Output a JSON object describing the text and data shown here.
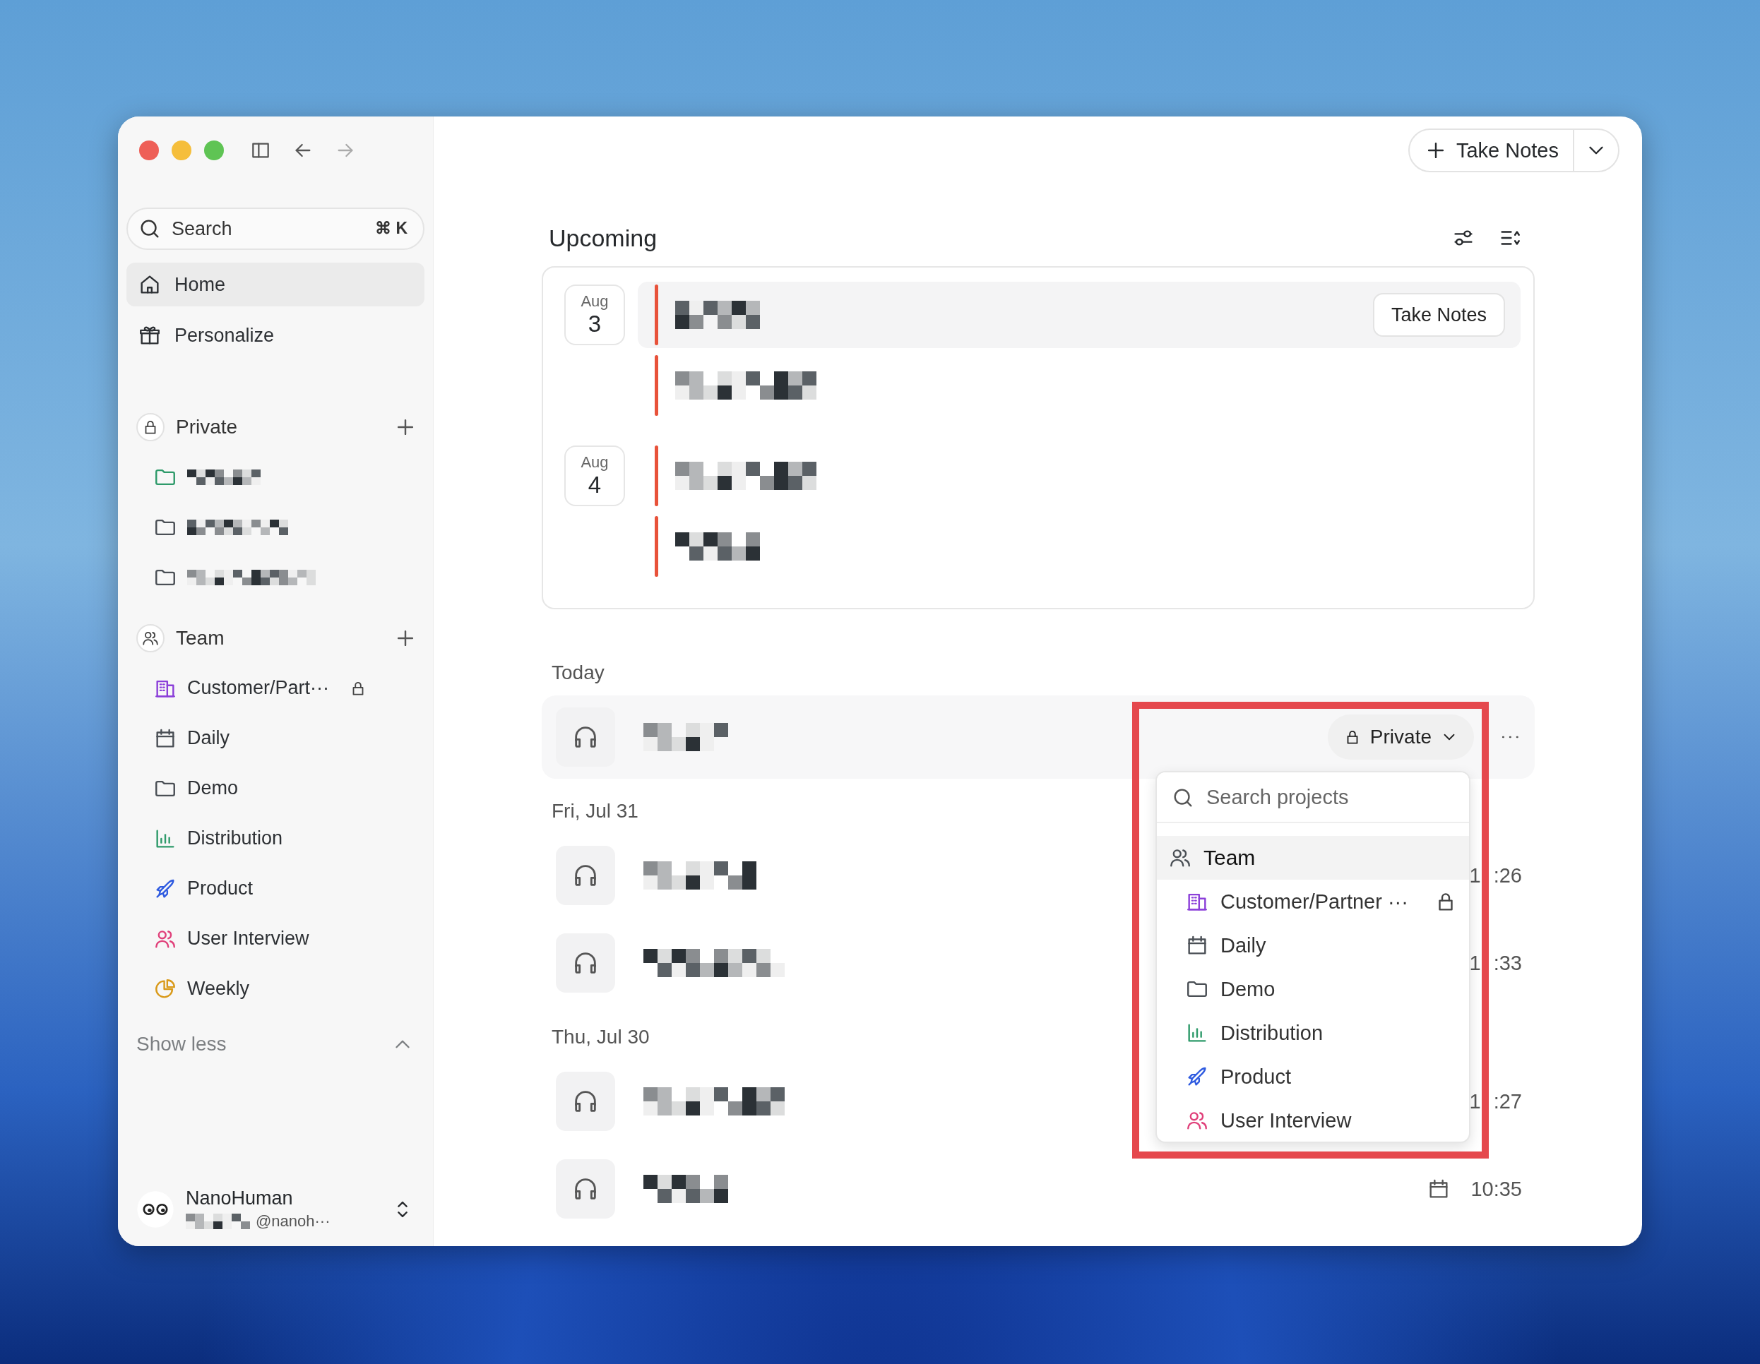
{
  "sidebar": {
    "search": {
      "placeholder": "Search",
      "shortcut": "⌘ K"
    },
    "nav": [
      {
        "label": "Home",
        "selected": true
      },
      {
        "label": "Personalize",
        "selected": false
      }
    ],
    "sections": [
      {
        "title": "Private",
        "items": [
          {
            "kind": "folder",
            "color": "#2e9a6a",
            "selected": false
          },
          {
            "kind": "folder",
            "color": "#4a4f55",
            "selected": false
          },
          {
            "kind": "folder",
            "color": "#4a4f55",
            "selected": false
          }
        ]
      },
      {
        "title": "Team",
        "items": [
          {
            "kind": "building",
            "color": "#8b3fd9",
            "label": "Customer/Part···",
            "locked": true,
            "selected": false
          },
          {
            "kind": "calendar",
            "color": "#4a4f55",
            "label": "Daily",
            "locked": false,
            "selected": false
          },
          {
            "kind": "folder",
            "color": "#4a4f55",
            "label": "Demo",
            "locked": false,
            "selected": false
          },
          {
            "kind": "chart",
            "color": "#2e9a6a",
            "label": "Distribution",
            "locked": false,
            "selected": false
          },
          {
            "kind": "rocket",
            "color": "#2f5be0",
            "label": "Product",
            "locked": false,
            "selected": false
          },
          {
            "kind": "users",
            "color": "#e0407a",
            "label": "User Interview",
            "locked": false,
            "selected": false
          },
          {
            "kind": "pie",
            "color": "#d99a1a",
            "label": "Weekly",
            "locked": false,
            "selected": false
          }
        ]
      }
    ],
    "show_less": "Show less",
    "user": {
      "name": "NanoHuman",
      "email": "@nanoh···"
    }
  },
  "header": {
    "button": "Take Notes"
  },
  "upcoming": {
    "title": "Upcoming",
    "days": [
      {
        "month": "Aug",
        "day": "3",
        "events": [
          {
            "kind": "active",
            "action": "Take Notes"
          },
          {
            "kind": "plain"
          }
        ]
      },
      {
        "month": "Aug",
        "day": "4",
        "events": [
          {
            "kind": "plain"
          },
          {
            "kind": "plain"
          }
        ]
      }
    ]
  },
  "recordings": [
    {
      "label": "Today",
      "items": [
        {
          "project": "Private",
          "menu": {
            "placeholder": "Search projects",
            "items": [
              {
                "label": "Team",
                "kind": "users",
                "color": "#4a4f55",
                "selected": true,
                "children": [
                  {
                    "label": "Customer/Partner ···",
                    "kind": "building",
                    "color": "#8b3fd9",
                    "locked": true,
                    "selected": false
                  },
                  {
                    "label": "Daily",
                    "kind": "calendar",
                    "color": "#4a4f55",
                    "locked": false,
                    "selected": false
                  },
                  {
                    "label": "Demo",
                    "kind": "folder",
                    "color": "#4a4f55",
                    "locked": false,
                    "selected": false
                  },
                  {
                    "label": "Distribution",
                    "kind": "chart",
                    "color": "#2e9a6a",
                    "locked": false,
                    "selected": false
                  },
                  {
                    "label": "Product",
                    "kind": "rocket",
                    "color": "#2f5be0",
                    "locked": false,
                    "selected": false
                  },
                  {
                    "label": "User Interview",
                    "kind": "users",
                    "color": "#e0407a",
                    "locked": false,
                    "selected": false
                  }
                ]
              }
            ]
          }
        }
      ]
    },
    {
      "label": "Fri, Jul 31",
      "items": [
        {
          "time": [
            "1",
            ":26"
          ],
          "scheduled": false
        },
        {
          "time": [
            "1",
            ":33"
          ],
          "scheduled": false
        }
      ]
    },
    {
      "label": "Thu, Jul 30",
      "items": [
        {
          "time": [
            "1",
            ":27"
          ],
          "scheduled": false
        },
        {
          "time": [
            "10:35"
          ],
          "scheduled": true
        }
      ]
    }
  ]
}
